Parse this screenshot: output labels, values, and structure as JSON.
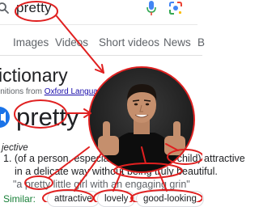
{
  "search": {
    "query": "pretty"
  },
  "tabs": [
    {
      "label": "Images"
    },
    {
      "label": "Videos"
    },
    {
      "label": "Short videos"
    },
    {
      "label": "News"
    },
    {
      "label": "B"
    }
  ],
  "dictionary": {
    "title": "ictionary",
    "definitions_prefix": "initions from ",
    "definitions_source": "Oxford Langua",
    "headword": "pretty",
    "part_of_speech": "jective",
    "definition_line1": "1.  (of a person, especially a woman or child) attractive",
    "definition_line2": "in a delicate way without being truly beautiful.",
    "example": "\"a pretty little girl with an engaging grin\"",
    "similar_label": "Similar:",
    "similar": [
      "attractive",
      "lovely",
      "good-looking"
    ]
  },
  "colors": {
    "annotation": "#e02020",
    "link": "#1a0dab",
    "accent": "#1a73e8",
    "similar_label": "#188038"
  }
}
